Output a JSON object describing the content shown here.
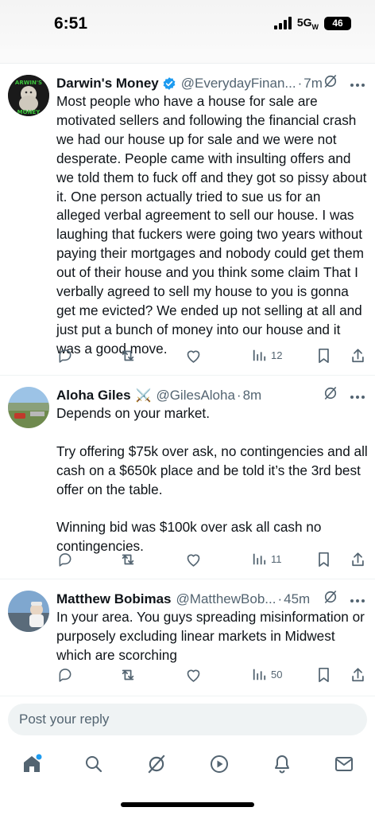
{
  "status": {
    "time": "6:51",
    "network": "5G",
    "battery": "46"
  },
  "tweets": [
    {
      "name": "Darwin's Money",
      "verified": true,
      "handle": "@EverydayFinan...",
      "separator": "·",
      "time": "7m",
      "avatar_text_top": "ARWIN'S",
      "avatar_text_bottom": "MONEY",
      "text": "Most people who have a house for sale are motivated sellers and following the financial crash we had our house up for sale and we were not desperate. People came with insulting offers and we told them to fuck off and they got so pissy about it. One person actually tried to sue us for an alleged verbal agreement to sell our house. I was laughing that fuckers were going two years without paying their mortgages and nobody could get them out of their house and you think some claim That I verbally agreed to sell my house to you is gonna get me evicted? We ended up not selling at all and just put a bunch of money into our house and it was a good move.",
      "views": "12"
    },
    {
      "name": "Aloha Giles",
      "emoji": "⚔️",
      "handle": "@GilesAloha",
      "separator": "·",
      "time": "8m",
      "text": "Depends on your market.\n\nTry offering $75k over ask, no contingencies and all cash on a $650k place and be told it’s the 3rd best offer on the table.\n\nWinning bid was $100k over ask all cash no contingencies.",
      "views": "11"
    },
    {
      "name": "Matthew Bobimas",
      "handle": "@MatthewBob...",
      "separator": "·",
      "time": "45m",
      "text": "In your area. You guys spreading misinformation or purposely excluding linear markets in Midwest which are scorching",
      "views": "50"
    }
  ],
  "reply": {
    "placeholder": "Post your reply"
  },
  "colors": {
    "accent": "#1d9bf0",
    "muted": "#536471",
    "text": "#0f1419"
  },
  "icons": [
    "reply-icon",
    "retweet-icon",
    "like-icon",
    "views-icon",
    "bookmark-icon",
    "share-icon",
    "grok-icon",
    "more-icon",
    "home-icon",
    "search-icon",
    "play-icon",
    "bell-icon",
    "mail-icon"
  ]
}
